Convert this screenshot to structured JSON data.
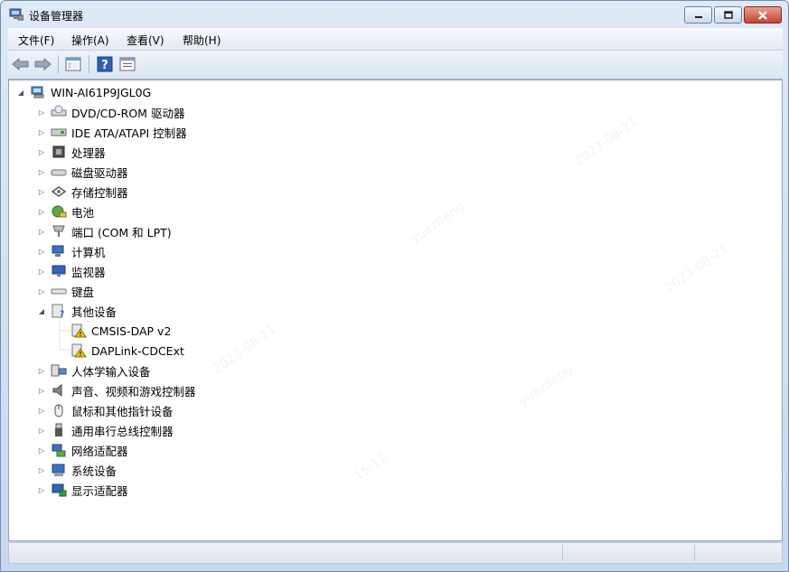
{
  "window": {
    "title": "设备管理器"
  },
  "menu": [
    "文件(F)",
    "操作(A)",
    "查看(V)",
    "帮助(H)"
  ],
  "tree": {
    "root": "WIN-AI61P9JGL0G",
    "categories": [
      {
        "label": "DVD/CD-ROM 驱动器",
        "icon": "dvd-drive-icon"
      },
      {
        "label": "IDE ATA/ATAPI 控制器",
        "icon": "ide-controller-icon"
      },
      {
        "label": "处理器",
        "icon": "processor-icon"
      },
      {
        "label": "磁盘驱动器",
        "icon": "disk-drive-icon"
      },
      {
        "label": "存储控制器",
        "icon": "storage-controller-icon"
      },
      {
        "label": "电池",
        "icon": "battery-icon"
      },
      {
        "label": "端口 (COM 和 LPT)",
        "icon": "port-icon"
      },
      {
        "label": "计算机",
        "icon": "computer-icon"
      },
      {
        "label": "监视器",
        "icon": "monitor-icon"
      },
      {
        "label": "键盘",
        "icon": "keyboard-icon"
      },
      {
        "label": "其他设备",
        "icon": "other-devices-icon",
        "expanded": true,
        "children": [
          {
            "label": "CMSIS-DAP v2",
            "icon": "warning-device-icon"
          },
          {
            "label": "DAPLink-CDCExt",
            "icon": "warning-device-icon"
          }
        ]
      },
      {
        "label": "人体学输入设备",
        "icon": "hid-icon"
      },
      {
        "label": "声音、视频和游戏控制器",
        "icon": "speaker-icon"
      },
      {
        "label": "鼠标和其他指针设备",
        "icon": "mouse-icon"
      },
      {
        "label": "通用串行总线控制器",
        "icon": "usb-icon"
      },
      {
        "label": "网络适配器",
        "icon": "network-adapter-icon"
      },
      {
        "label": "系统设备",
        "icon": "system-device-icon"
      },
      {
        "label": "显示适配器",
        "icon": "display-adapter-icon"
      }
    ]
  },
  "watermark": {
    "user": "yuezifeng",
    "date": "2023-08-21",
    "time": "15:11"
  },
  "colors": {
    "frame": "#c7d8ee",
    "close_button": "#c4452c",
    "warning": "#f2c300"
  }
}
